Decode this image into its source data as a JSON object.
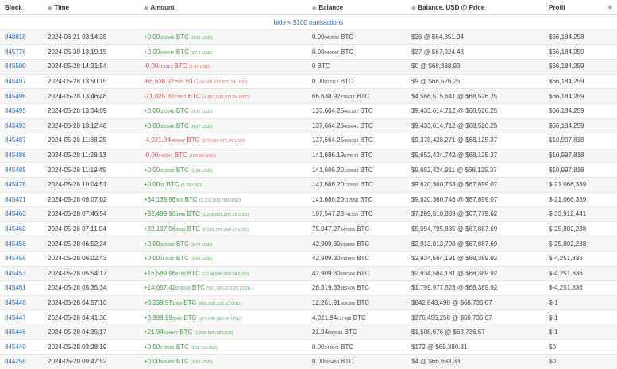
{
  "headers": {
    "block": "Block",
    "time": "Time",
    "amount": "Amount",
    "balance": "Balance",
    "balance_usd": "Balance, USD @ Price",
    "profit": "Profit"
  },
  "toggle_label": "hide < $100 transactions",
  "rows": [
    {
      "block": "848818",
      "time": "2024-06-21 03:14:35",
      "amt_sign": "pos",
      "amt_main": "+0.00",
      "amt_small": "000546",
      "amt_unit": "BTC",
      "amt_usd": "(0.35 USD)",
      "bal_main": "0.00",
      "bal_small": "040593",
      "bal_unit": "BTC",
      "bal_usd": "$26 @ $64,851.94",
      "profit": "$66,184,258"
    },
    {
      "block": "845776",
      "time": "2024-05-30 13:19:15",
      "amt_sign": "pos",
      "amt_main": "+0.00",
      "amt_small": "040047",
      "amt_unit": "BTC",
      "amt_usd": "(27.2 USD)",
      "bal_main": "0.00",
      "bal_small": "040047",
      "bal_unit": "BTC",
      "bal_usd": "$27 @ $67,924.48",
      "profit": "$66,184,259"
    },
    {
      "block": "845500",
      "time": "2024-05-28 14:31:54",
      "amt_sign": "neg",
      "amt_main": "-0.00",
      "amt_small": "013117",
      "amt_unit": "BTC",
      "amt_usd": "(8.97 USD)",
      "bal_main": "0 BTC",
      "bal_small": "",
      "bal_unit": "",
      "bal_usd": "$0 @ $68,388.93",
      "profit": "$66,184,259"
    },
    {
      "block": "845497",
      "time": "2024-05-28 13:50:15",
      "amt_sign": "neg",
      "amt_main": "-66,638.92",
      "amt_small": "7635",
      "amt_unit": "BTC",
      "amt_usd": "(4,566,515,632.14 USD)",
      "bal_main": "0.00",
      "bal_small": "013117",
      "bal_unit": "BTC",
      "bal_usd": "$9 @ $68,526.25",
      "profit": "$66,184,259"
    },
    {
      "block": "845496",
      "time": "2024-05-28 13:46:48",
      "amt_sign": "neg",
      "amt_main": "-71,025.32",
      "amt_small": "62957",
      "amt_unit": "BTC",
      "amt_usd": "(4,867,099,071.34 USD)",
      "bal_main": "66,638.92",
      "bal_small": "776617",
      "bal_unit": "BTC",
      "bal_usd": "$4,566,515,641 @ $68,526.25",
      "profit": "$66,184,259"
    },
    {
      "block": "845495",
      "time": "2024-05-28 13:34:09",
      "amt_sign": "pos",
      "amt_main": "+0.00",
      "amt_small": "000546",
      "amt_unit": "BTC",
      "amt_usd": "(0.37 USD)",
      "bal_main": "137,664.25",
      "bal_small": "406187",
      "bal_unit": "BTC",
      "bal_usd": "$9,433,614,712 @ $68,526.25",
      "profit": "$66,184,259"
    },
    {
      "block": "845493",
      "time": "2024-05-28 13:12:48",
      "amt_sign": "pos",
      "amt_main": "+0.00",
      "amt_small": "000546",
      "amt_unit": "BTC",
      "amt_usd": "(0.37 USD)",
      "bal_main": "137,664.25",
      "bal_small": "405641",
      "bal_unit": "BTC",
      "bal_usd": "$9,433,614,712 @ $68,526.25",
      "profit": "$66,184,259"
    },
    {
      "block": "845487",
      "time": "2024-05-28 11:38:25",
      "amt_sign": "neg",
      "amt_main": "-4,021.94",
      "amt_small": "469447",
      "amt_unit": "BTC",
      "amt_usd": "(273,996,471.24 USD)",
      "bal_main": "137,664.25",
      "bal_small": "405095",
      "bal_unit": "BTC",
      "bal_usd": "$9,378,428,271 @ $68,125.37",
      "profit": "$10,997,818"
    },
    {
      "block": "845486",
      "time": "2024-05-28 11:28:13",
      "amt_sign": "neg",
      "amt_main": "-0.00",
      "amt_small": "240041",
      "amt_unit": "BTC",
      "amt_usd": "(166.95 USD)",
      "bal_main": "141,686.19",
      "bal_small": "874542",
      "bal_unit": "BTC",
      "bal_usd": "$9,652,424,742 @ $68,125.37",
      "profit": "$10,997,818"
    },
    {
      "block": "845485",
      "time": "2024-05-28 11:19:45",
      "amt_sign": "pos",
      "amt_main": "+0.00",
      "amt_small": "002020",
      "amt_unit": "BTC",
      "amt_usd": "(1.38 USD)",
      "bal_main": "141,686.20",
      "bal_small": "122583",
      "bal_unit": "BTC",
      "bal_usd": "$9,652,424,911 @ $68,125.37",
      "profit": "$10,997,818"
    },
    {
      "block": "845478",
      "time": "2024-05-28 10:04:51",
      "amt_sign": "pos",
      "amt_main": "+0.00",
      "amt_small": "01",
      "amt_unit": "BTC",
      "amt_usd": "(6.79 USD)",
      "bal_main": "141,686.20",
      "bal_small": "120560",
      "bal_unit": "BTC",
      "bal_usd": "$9,620,360,753 @ $67,899.07",
      "profit": "$-21,066,339"
    },
    {
      "block": "845471",
      "time": "2024-05-28 09:07:02",
      "amt_sign": "pos",
      "amt_main": "+34,138.96",
      "amt_small": "369",
      "amt_unit": "BTC",
      "amt_usd": "(2,318,003,758 USD)",
      "bal_main": "141,686.20",
      "bal_small": "110558",
      "bal_unit": "BTC",
      "bal_usd": "$9,620,360,746 @ $67,899.07",
      "profit": "$-21,066,339"
    },
    {
      "block": "845463",
      "time": "2024-05-28 07:46:54",
      "amt_sign": "pos",
      "amt_main": "+32,499.96",
      "amt_small": "3945",
      "amt_unit": "BTC",
      "amt_usd": "(2,209,835,207.55 USD)",
      "bal_main": "107,547.23",
      "bal_small": "741558",
      "bal_unit": "BTC",
      "bal_usd": "$7,289,510,889 @ $67,779.62",
      "profit": "$-33,912,441"
    },
    {
      "block": "845460",
      "time": "2024-05-28 07:11:04",
      "amt_sign": "pos",
      "amt_main": "+32,137.96",
      "amt_small": "4331",
      "amt_unit": "BTC",
      "amt_usd": "(2,181,772,054.57 USD)",
      "bal_main": "75,047.27",
      "bal_small": "347058",
      "bal_unit": "BTC",
      "bal_usd": "$5,094,795,885 @ $67,887.69",
      "profit": "$-25,802,238"
    },
    {
      "block": "845458",
      "time": "2024-05-28 06:52:34",
      "amt_sign": "pos",
      "amt_main": "+0.00",
      "amt_small": "001092",
      "amt_unit": "BTC",
      "amt_usd": "(0.74 USD)",
      "bal_main": "42,909.30",
      "bal_small": "913053",
      "bal_unit": "BTC",
      "bal_usd": "$2,913,013,790 @ $67,887.69",
      "profit": "$-25,802,238"
    },
    {
      "block": "845455",
      "time": "2024-05-28 06:02:43",
      "amt_sign": "pos",
      "amt_main": "+0.00",
      "amt_small": "014562",
      "amt_unit": "BTC",
      "amt_usd": "(9.96 USD)",
      "bal_main": "42,909.30",
      "bal_small": "912066",
      "bal_unit": "BTC",
      "bal_usd": "$2,934,564,191 @ $68,389.92",
      "profit": "$-4,251,836"
    },
    {
      "block": "845453",
      "time": "2024-05-28 05:54:17",
      "amt_sign": "pos",
      "amt_main": "+16,589.96",
      "amt_small": "8159",
      "amt_unit": "BTC",
      "amt_usd": "(1,134,586,653.04 USD)",
      "bal_main": "42,909.30",
      "bal_small": "896304",
      "bal_unit": "BTC",
      "bal_usd": "$2,934,564,181 @ $68,389.92",
      "profit": "$-4,251,836"
    },
    {
      "block": "845451",
      "time": "2024-05-28 05:35:34",
      "amt_sign": "pos",
      "amt_main": "+14,057.42",
      "amt_small": "076016",
      "amt_unit": "BTC",
      "amt_usd": "(961,365,072.26 USD)",
      "bal_main": "26,319.33",
      "bal_small": "982404",
      "bal_unit": "BTC",
      "bal_usd": "$1,799,977,528 @ $68,389.92",
      "profit": "$-4,251,836"
    },
    {
      "block": "845448",
      "time": "2024-05-28 04:57:16",
      "amt_sign": "pos",
      "amt_main": "+8,239.97",
      "amt_small": "1509",
      "amt_unit": "BTC",
      "amt_usd": "(566,308,232.63 USD)",
      "bal_main": "12,261.91",
      "bal_small": "906388",
      "bal_unit": "BTC",
      "bal_usd": "$842,843,490 @ $68,736.67",
      "profit": "$-1"
    },
    {
      "block": "845447",
      "time": "2024-05-28 04:41:36",
      "amt_sign": "pos",
      "amt_main": "+3,999.99",
      "amt_small": "8545",
      "amt_unit": "BTC",
      "amt_usd": "(274,946,562.04 USD)",
      "bal_main": "4,021.94",
      "bal_small": "717488",
      "bal_unit": "BTC",
      "bal_usd": "$276,455,258 @ $68,736.67",
      "profit": "$-1"
    },
    {
      "block": "845446",
      "time": "2024-05-28 04:35:17",
      "amt_sign": "pos",
      "amt_main": "+21.94",
      "amt_small": "614847",
      "amt_unit": "BTC",
      "amt_usd": "(1,508,505.18 USD)",
      "bal_main": "21.94",
      "bal_small": "862888",
      "bal_unit": "BTC",
      "bal_usd": "$1,508,676 @ $68,736.67",
      "profit": "$-1"
    },
    {
      "block": "845440",
      "time": "2024-05-28 03:28:19",
      "amt_sign": "pos",
      "amt_main": "+0.00",
      "amt_small": "242591",
      "amt_unit": "BTC",
      "amt_usd": "(168.31 USD)",
      "bal_main": "0.00",
      "bal_small": "248041",
      "bal_unit": "BTC",
      "bal_usd": "$172 @ $69,380.81",
      "profit": "$0"
    },
    {
      "block": "844258",
      "time": "2024-05-20 09:47:52",
      "amt_sign": "pos",
      "amt_main": "+0.00",
      "amt_small": "005450",
      "amt_unit": "BTC",
      "amt_usd": "(3.63 USD)",
      "bal_main": "0.00",
      "bal_small": "005450",
      "bal_unit": "BTC",
      "bal_usd": "$4 @ $66,693.33",
      "profit": "$0"
    }
  ]
}
